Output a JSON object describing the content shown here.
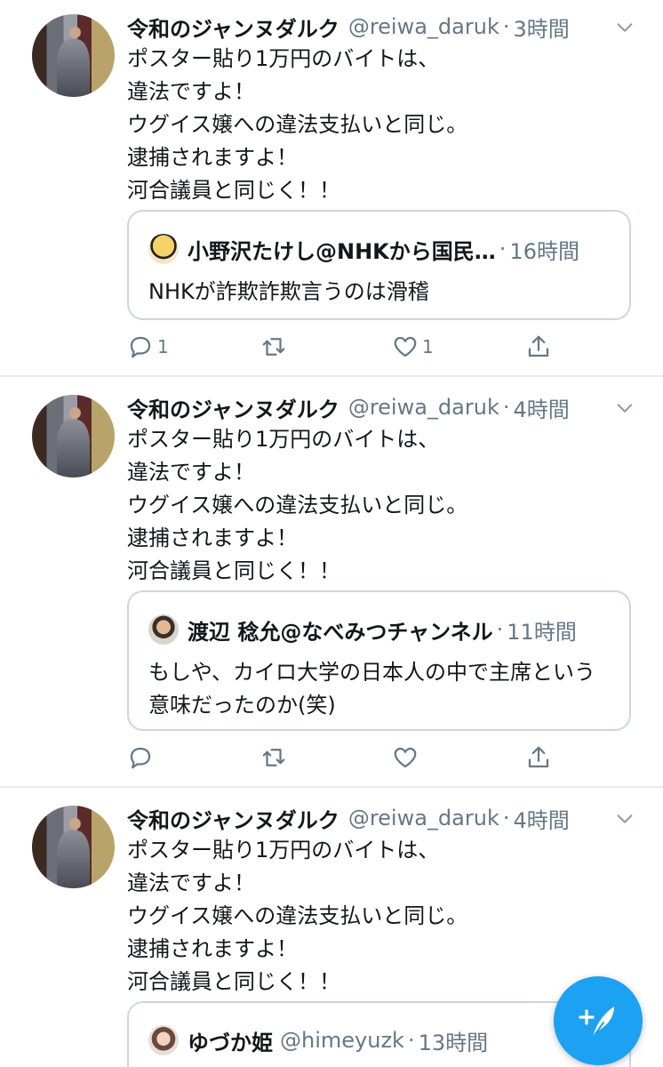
{
  "tweets": [
    {
      "name": "令和のジャンヌダルク",
      "handle": "@reiwa_daruk",
      "time": "3時間",
      "text": "ポスター貼り1万円のバイトは、\n違法ですよ！\nウグイス嬢への違法支払いと同じ。\n逮捕されますよ！\n河合議員と同じく！！",
      "quote": {
        "name": "小野沢たけし@NHKから国民…",
        "handle": "",
        "time": "16時間",
        "text": "NHKが詐欺詐欺言うのは滑稽"
      },
      "reply_count": "1",
      "like_count": "1"
    },
    {
      "name": "令和のジャンヌダルク",
      "handle": "@reiwa_daruk",
      "time": "4時間",
      "text": "ポスター貼り1万円のバイトは、\n違法ですよ！\nウグイス嬢への違法支払いと同じ。\n逮捕されますよ！\n河合議員と同じく！！",
      "quote": {
        "name": "渡辺 稔允@なべみつチャンネル",
        "handle": "",
        "time": "11時間",
        "text": "もしや、カイロ大学の日本人の中で主席という意味だったのか(笑)"
      },
      "reply_count": "",
      "like_count": ""
    },
    {
      "name": "令和のジャンヌダルク",
      "handle": "@reiwa_daruk",
      "time": "4時間",
      "text": "ポスター貼り1万円のバイトは、\n違法ですよ！\nウグイス嬢への違法支払いと同じ。\n逮捕されますよ！\n河合議員と同じく！！",
      "quote": {
        "name": "ゆづか姫",
        "handle": "@himeyuzk",
        "time": "13時間",
        "text": ""
      }
    }
  ],
  "separator": "·",
  "icons": {
    "chevron": "chevron-down-icon",
    "reply": "reply-icon",
    "retweet": "retweet-icon",
    "like": "heart-icon",
    "share": "share-icon",
    "compose": "compose-tweet-icon"
  },
  "colors": {
    "accent": "#1da1f2",
    "muted": "#657786",
    "border": "#ccd6dd",
    "text": "#14171a"
  }
}
